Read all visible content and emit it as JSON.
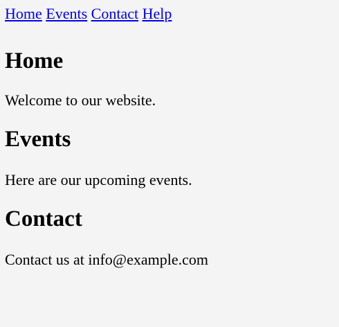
{
  "nav": {
    "items": [
      {
        "label": "Home"
      },
      {
        "label": "Events"
      },
      {
        "label": "Contact"
      },
      {
        "label": "Help"
      }
    ]
  },
  "sections": [
    {
      "heading": "Home",
      "text": "Welcome to our website."
    },
    {
      "heading": "Events",
      "text": "Here are our upcoming events."
    },
    {
      "heading": "Contact",
      "text": "Contact us at info@example.com"
    }
  ],
  "colors": {
    "background": "#f4f4f4",
    "link": "#0000ee",
    "text": "#000000"
  }
}
